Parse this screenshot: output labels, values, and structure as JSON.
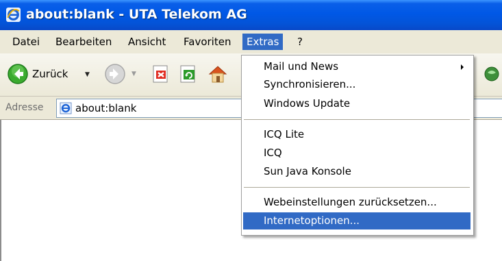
{
  "window": {
    "title": "about:blank - UTA Telekom AG"
  },
  "menubar": {
    "items": [
      "Datei",
      "Bearbeiten",
      "Ansicht",
      "Favoriten",
      "Extras",
      "?"
    ],
    "active": "Extras"
  },
  "toolbar": {
    "back_label": "Zurück"
  },
  "address": {
    "label": "Adresse",
    "url": "about:blank"
  },
  "extras_menu": {
    "groups": [
      [
        "Mail und News",
        "Synchronisieren...",
        "Windows Update"
      ],
      [
        "ICQ Lite",
        "ICQ",
        "Sun Java Konsole"
      ],
      [
        "Webeinstellungen zurücksetzen...",
        "Internetoptionen..."
      ]
    ],
    "highlighted": "Internetoptionen..."
  },
  "colors": {
    "titlebar": "#0058e6",
    "menu_highlight": "#316ac5",
    "menubar_bg": "#ece9d8"
  }
}
